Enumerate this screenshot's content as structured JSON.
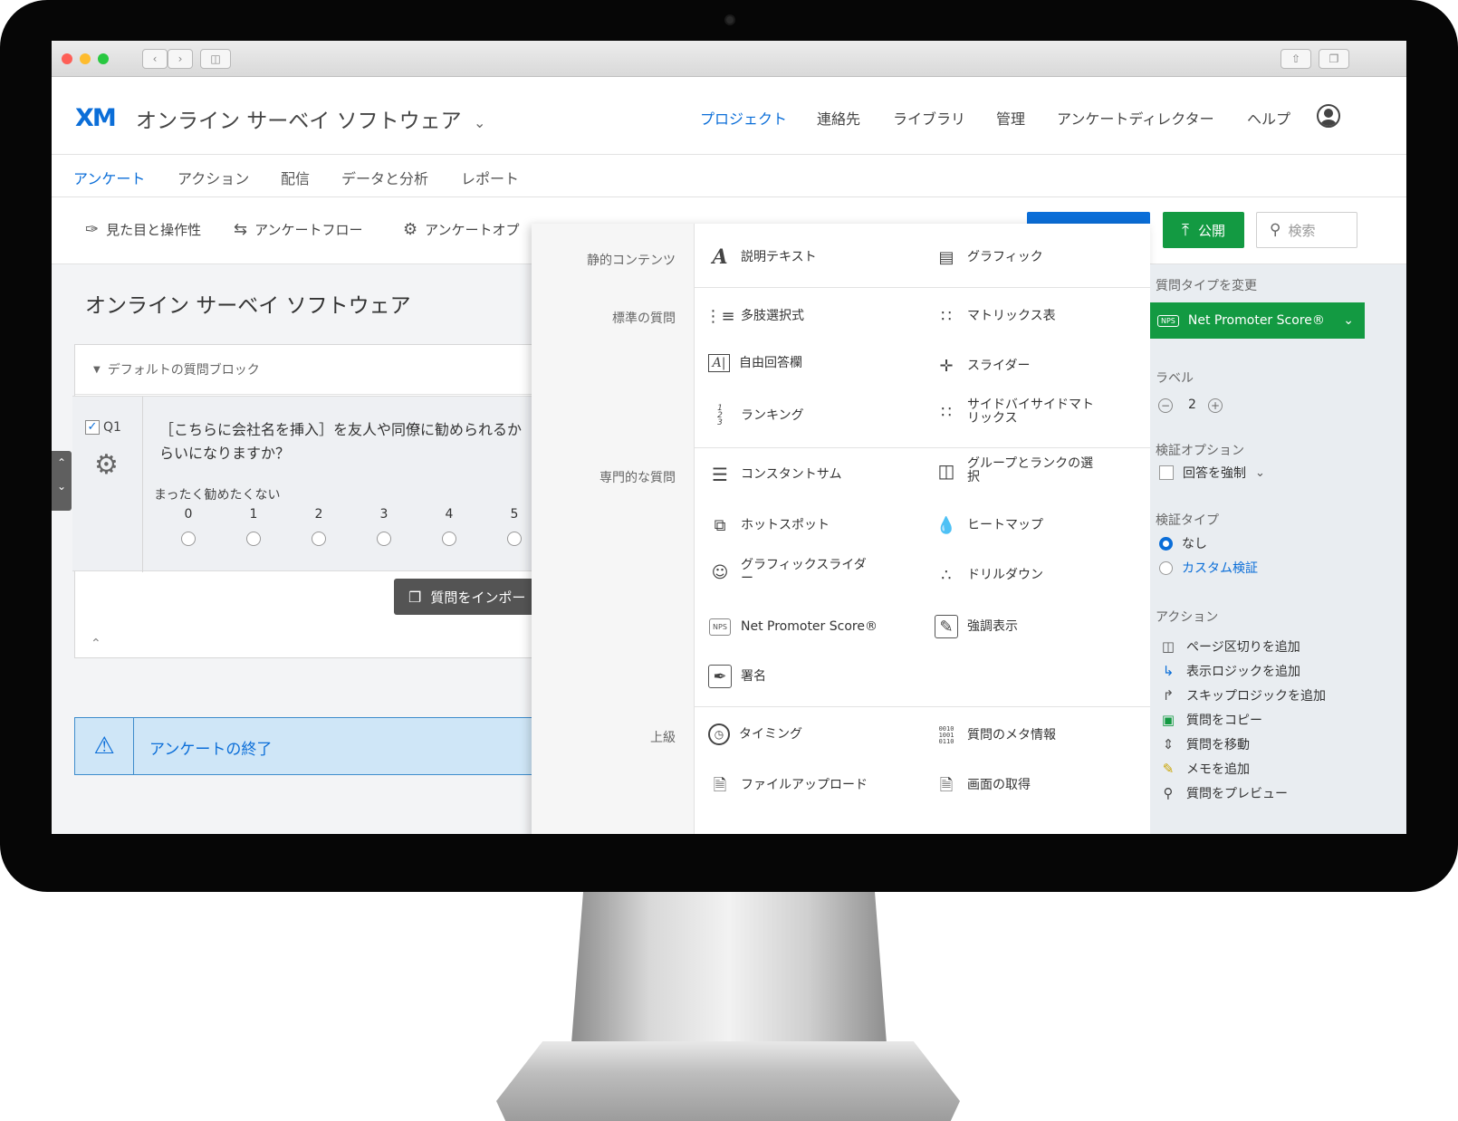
{
  "app": {
    "logo_text": "XM",
    "title": "オンライン サーベイ ソフトウェア",
    "title_caret": "⌄",
    "top_nav": [
      "プロジェクト",
      "連絡先",
      "ライブラリ",
      "管理",
      "アンケートディレクター",
      "ヘルプ"
    ]
  },
  "sub_tabs": [
    "アンケート",
    "アクション",
    "配信",
    "データと分析",
    "レポート"
  ],
  "toolbar": {
    "look_and_feel": "見た目と操作性",
    "survey_flow": "アンケートフロー",
    "survey_options": "アンケートオプ",
    "publish": "公開",
    "search_placeholder": "検索"
  },
  "editor": {
    "survey_name": "オンライン サーベイ ソフトウェア",
    "block_title": "デフォルトの質問ブロック",
    "question": {
      "id": "Q1",
      "text": "［こちらに会社名を挿入］を友人や同僚に勧められるかいらいになりますか？",
      "text_line1": "［こちらに会社名を挿入］を友人や同僚に勧められるか",
      "text_line2": "らいになりますか？",
      "low_anchor": "まったく勧めたくない",
      "scale": [
        "0",
        "1",
        "2",
        "3",
        "4",
        "5"
      ]
    },
    "import_button": "質問をインポー",
    "end_of_survey": "アンケートの終了"
  },
  "question_types": {
    "categories": {
      "static": "静的コンテンツ",
      "standard": "標準の質問",
      "specialty": "専門的な質問",
      "advanced": "上級"
    },
    "static": [
      {
        "label": "説明テキスト",
        "icon": "text-A-icon"
      },
      {
        "label": "グラフィック",
        "icon": "image-icon"
      }
    ],
    "standard": [
      {
        "label": "多肢選択式",
        "icon": "multiple-choice-icon"
      },
      {
        "label": "マトリックス表",
        "icon": "matrix-icon"
      },
      {
        "label": "自由回答欄",
        "icon": "text-entry-icon"
      },
      {
        "label": "スライダー",
        "icon": "slider-icon"
      },
      {
        "label": "ランキング",
        "icon": "rank-order-icon"
      },
      {
        "label": "サイドバイサイドマトリックス",
        "label_line1": "サイドバイサイドマト",
        "label_line2": "リックス",
        "icon": "side-by-side-icon"
      }
    ],
    "specialty": [
      {
        "label": "コンスタントサム",
        "icon": "constant-sum-icon"
      },
      {
        "label": "グループとランクの選択",
        "label_line1": "グループとランクの選",
        "label_line2": "択",
        "icon": "pick-group-rank-icon"
      },
      {
        "label": "ホットスポット",
        "icon": "hot-spot-icon"
      },
      {
        "label": "ヒートマップ",
        "icon": "heat-map-icon"
      },
      {
        "label": "グラフィックスライダー",
        "label_line1": "グラフィックスライダ",
        "label_line2": "ー",
        "icon": "graphic-slider-icon"
      },
      {
        "label": "ドリルダウン",
        "icon": "drill-down-icon"
      },
      {
        "label": "Net Promoter Score®",
        "icon": "nps-icon",
        "badge": "NPS"
      },
      {
        "label": "強調表示",
        "icon": "highlight-icon"
      },
      {
        "label": "署名",
        "icon": "signature-icon"
      }
    ],
    "advanced": [
      {
        "label": "タイミング",
        "icon": "timing-icon"
      },
      {
        "label": "質問のメタ情報",
        "icon": "meta-info-icon"
      },
      {
        "label": "ファイルアップロード",
        "icon": "file-upload-icon"
      },
      {
        "label": "画面の取得",
        "icon": "screen-capture-icon"
      }
    ]
  },
  "properties": {
    "change_type_label": "質問タイプを変更",
    "selected_type": "Net Promoter Score®",
    "selected_badge": "NPS",
    "label_heading": "ラベル",
    "label_value": "2",
    "validation_options": "検証オプション",
    "force_response": "回答を強制",
    "validation_type": "検証タイプ",
    "validation_none": "なし",
    "validation_custom": "カスタム検証",
    "actions_heading": "アクション",
    "actions": [
      {
        "label": "ページ区切りを追加",
        "icon": "page-break-icon"
      },
      {
        "label": "表示ロジックを追加",
        "icon": "display-logic-icon"
      },
      {
        "label": "スキップロジックを追加",
        "icon": "skip-logic-icon"
      },
      {
        "label": "質問をコピー",
        "icon": "copy-icon"
      },
      {
        "label": "質問を移動",
        "icon": "move-icon"
      },
      {
        "label": "メモを追加",
        "icon": "note-icon"
      },
      {
        "label": "質問をプレビュー",
        "icon": "preview-icon"
      }
    ]
  },
  "colors": {
    "accent_blue": "#0b6ed8",
    "publish_green": "#139a42",
    "end_block_bg": "#cfe6f7"
  }
}
